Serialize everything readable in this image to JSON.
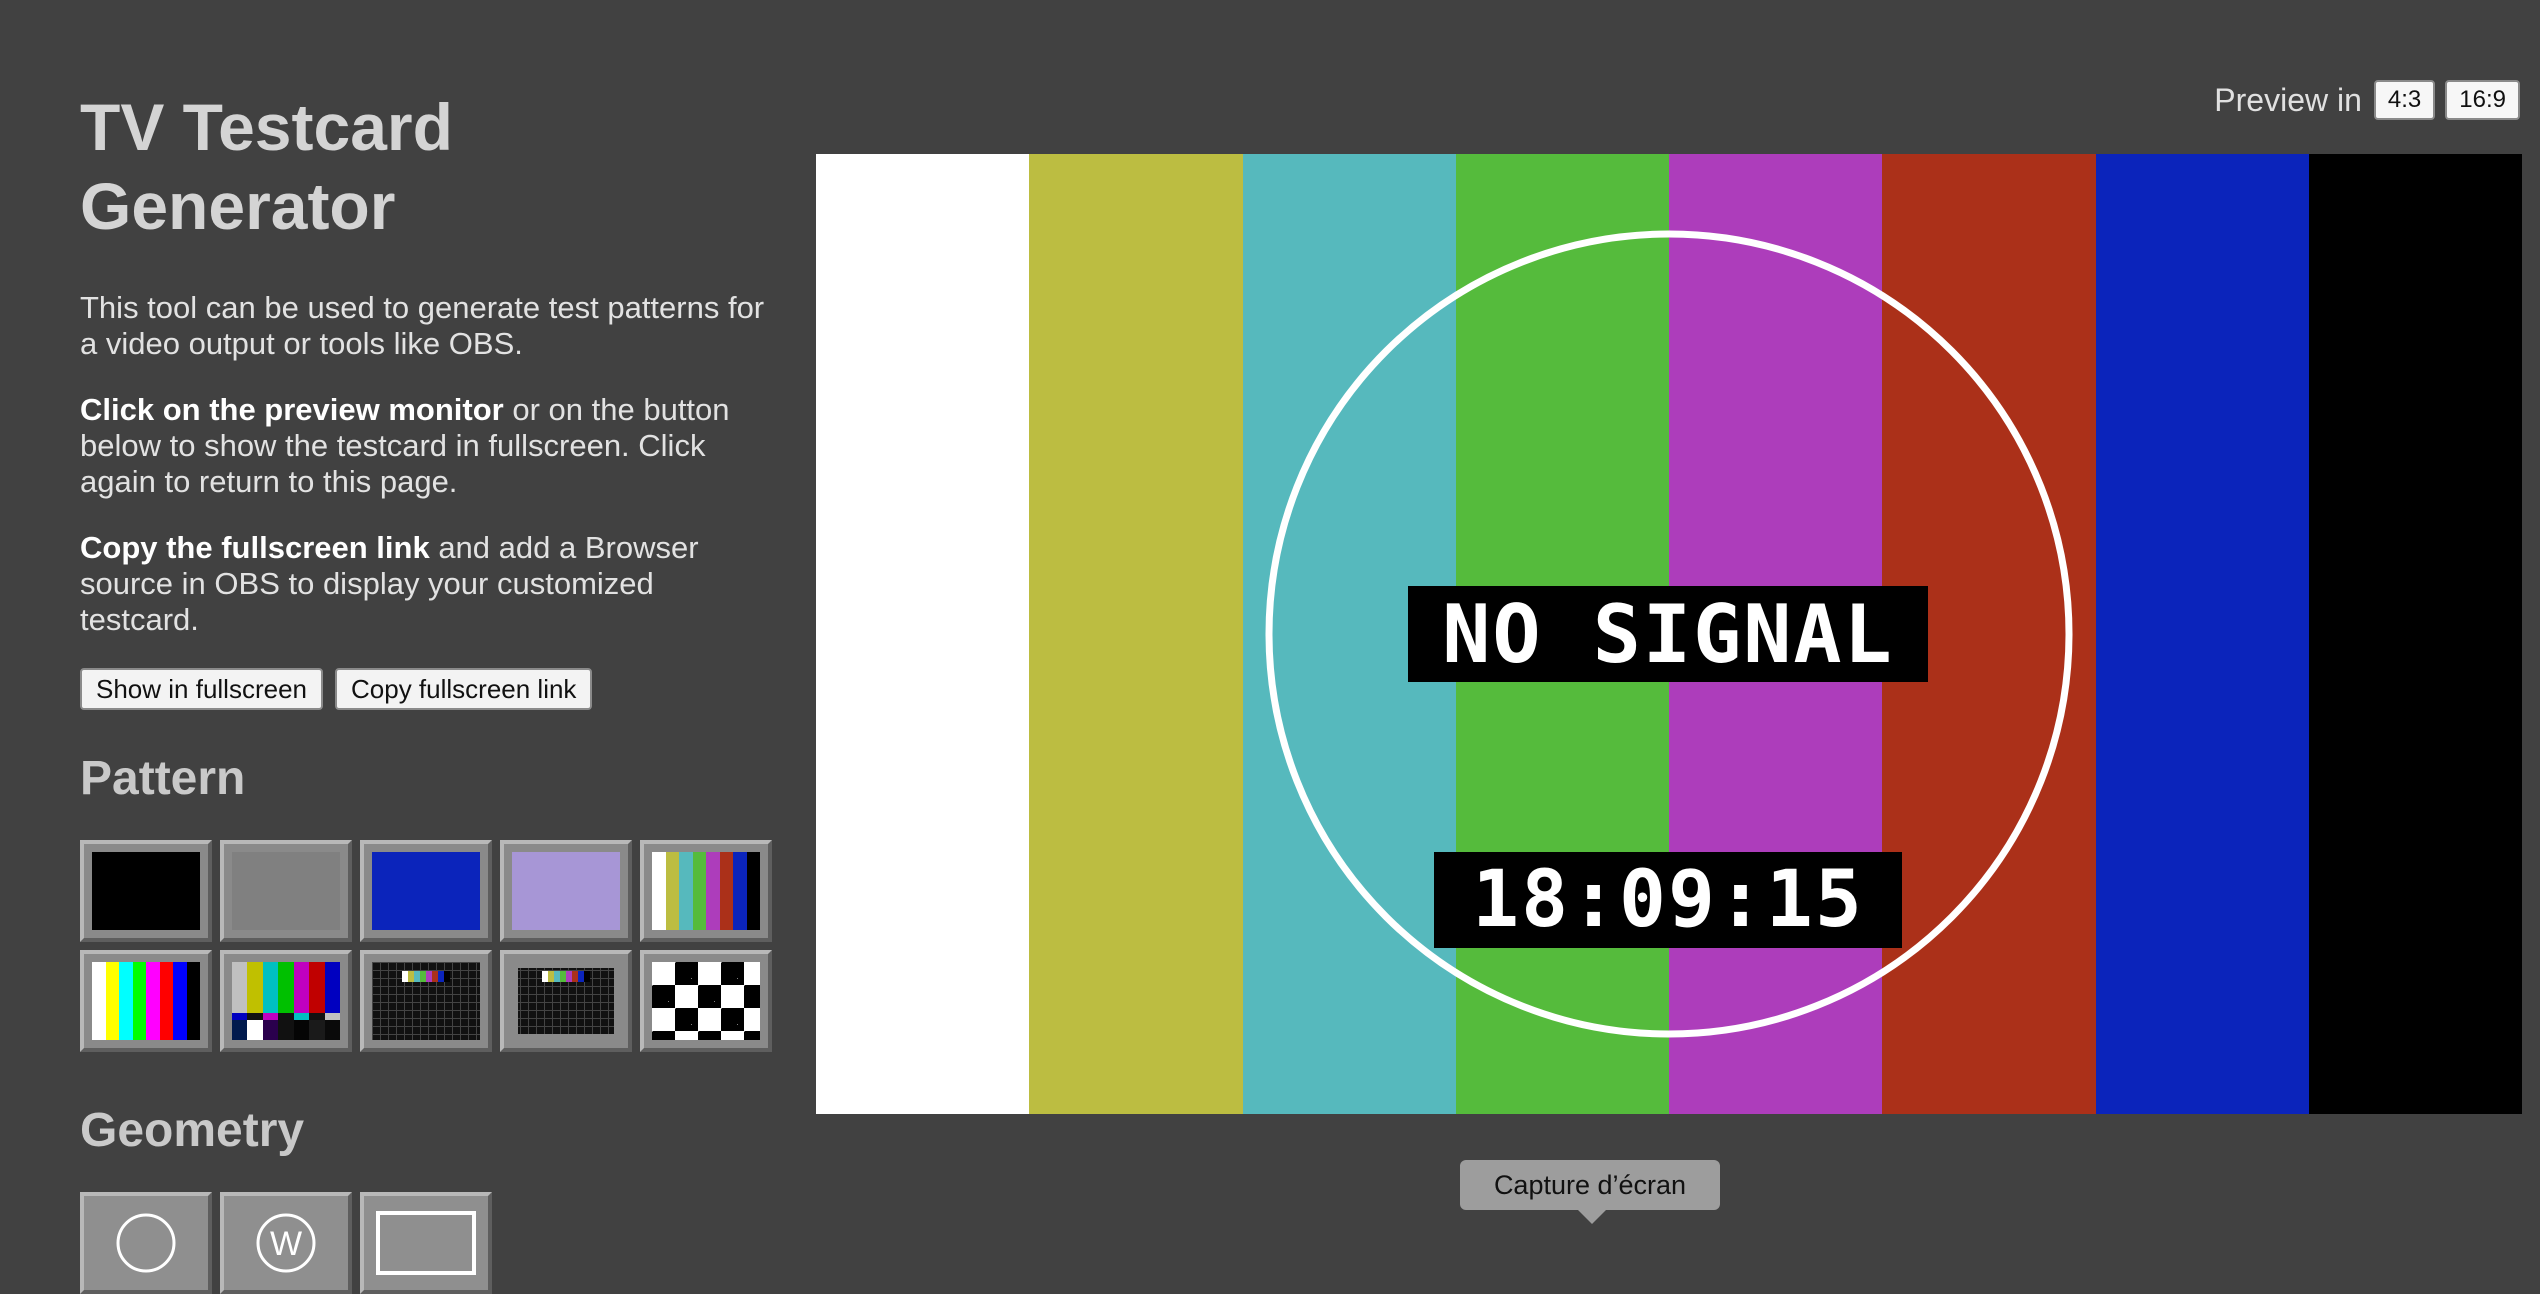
{
  "sidebar": {
    "title": "TV Testcard Generator",
    "intro": "This tool can be used to generate test patterns for a video output or tools like OBS.",
    "click_strong": "Click on the preview monitor",
    "click_rest": " or on the button below to show the testcard in fullscreen. Click again to return to this page.",
    "copy_strong": "Copy the fullscreen link",
    "copy_rest": " and add a Browser source in OBS to display your customized testcard.",
    "fullscreen_button": "Show in fullscreen",
    "copy_link_button": "Copy fullscreen link",
    "pattern_heading": "Pattern",
    "geometry_heading": "Geometry"
  },
  "preview": {
    "label": "Preview in",
    "ratio_4_3": "4:3",
    "ratio_16_9": "16:9"
  },
  "testcard": {
    "message": "NO SIGNAL",
    "clock": "18:09:15",
    "bar_colors": [
      "#ffffff",
      "#bcbd41",
      "#56b9bd",
      "#55bb3c",
      "#ad3dbb",
      "#ab3019",
      "#0b24bb",
      "#000000"
    ]
  },
  "patterns": [
    {
      "name": "black-pattern",
      "kind": "solid",
      "color": "#000000"
    },
    {
      "name": "gray-pattern",
      "kind": "solid",
      "color": "#808080"
    },
    {
      "name": "blue-pattern",
      "kind": "solid",
      "color": "#0b24bb"
    },
    {
      "name": "lavender-pattern",
      "kind": "solid",
      "color": "#a796d6"
    },
    {
      "name": "ebu-color-bars-pattern",
      "kind": "bars",
      "colors": [
        "#ffffff",
        "#bcbd41",
        "#56b9bd",
        "#55bb3c",
        "#ad3dbb",
        "#ab3019",
        "#0b24bb",
        "#000000"
      ]
    },
    {
      "name": "bright-color-bars-pattern",
      "kind": "bars",
      "colors": [
        "#ffffff",
        "#ffff00",
        "#00ffff",
        "#00ff00",
        "#ff00ff",
        "#ff0000",
        "#0000ff",
        "#000000"
      ]
    },
    {
      "name": "smpte-color-bars-pattern",
      "kind": "smpte"
    },
    {
      "name": "dark-grid-pattern",
      "kind": "grid"
    },
    {
      "name": "dark-grid-framed-pattern",
      "kind": "grid2"
    },
    {
      "name": "checkerboard-pattern",
      "kind": "checker"
    }
  ],
  "geometries": [
    {
      "name": "circle-geometry",
      "icon": "circle-icon"
    },
    {
      "name": "w-logo-geometry",
      "icon": "w-circle-icon",
      "letter": "W"
    },
    {
      "name": "frame-geometry",
      "icon": "rectangle-icon"
    }
  ],
  "tooltip": {
    "text": "Capture d’écran"
  }
}
